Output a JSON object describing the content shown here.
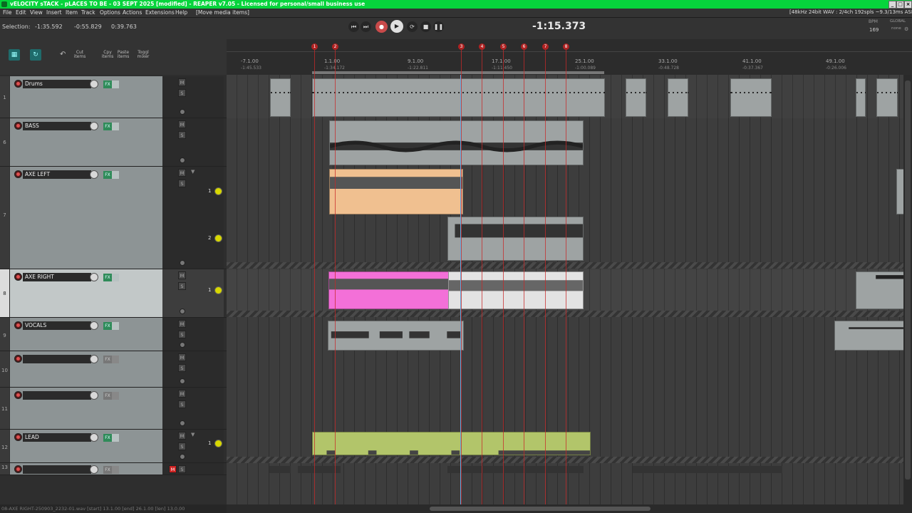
{
  "window": {
    "title": "vELOCITY sTACK - pLACES TO BE - 03 SEPT 2025 [modified] - REAPER v7.05 - Licensed for personal/small business use"
  },
  "menu": {
    "items": [
      "File",
      "Edit",
      "View",
      "Insert",
      "Item",
      "Track",
      "Options",
      "Actions",
      "Extensions",
      "Help",
      "[Move media items]"
    ],
    "audio_info": "[48kHz 24bit WAV : 2/4ch 192spls ~9.3/13ms ASIO]"
  },
  "selection": {
    "label": "Selection:",
    "start": "-1:35.592",
    "end": "-0:55.829",
    "length": "0:39.763"
  },
  "transport": {
    "time": "-1:15.373",
    "bpm_label": "BPM",
    "bpm": "169",
    "global_label": "GLOBAL",
    "none_label": "none"
  },
  "toolbar": {
    "cut_label": "Cut items",
    "copy_label": "Cpy items",
    "paste_label": "Paste items",
    "toggle_label": "Toggl mixer"
  },
  "ruler": {
    "bars": [
      "-7.1.00",
      "1.1.00",
      "9.1.00",
      "17.1.00",
      "25.1.00",
      "33.1.00",
      "41.1.00",
      "49.1.00"
    ],
    "times": [
      "-1:45.533",
      "-1:34.172",
      "-1:22.811",
      "-1:11.450",
      "-1:00.089",
      "-0:48.728",
      "-0:37.367",
      "-0:26.006"
    ],
    "markers": [
      "1",
      "2",
      "3",
      "4",
      "5",
      "6",
      "7",
      "8"
    ]
  },
  "tracks": [
    {
      "num": "1",
      "name": "Drums"
    },
    {
      "num": "6",
      "name": "BASS"
    },
    {
      "num": "7",
      "name": "AXE LEFT"
    },
    {
      "num": "8",
      "name": "AXE RIGHT"
    },
    {
      "num": "9",
      "name": "VOCALS"
    },
    {
      "num": "10",
      "name": ""
    },
    {
      "num": "11",
      "name": ""
    },
    {
      "num": "12",
      "name": "LEAD"
    },
    {
      "num": "13",
      "name": ""
    }
  ],
  "lanes": {
    "axe_left_1": "1",
    "axe_left_2": "2",
    "axe_right_1": "1",
    "lead_1": "1"
  },
  "buttons": {
    "fx": "FX",
    "mute": "M",
    "solo": "S"
  },
  "status": {
    "text": "08-AXE RIGHT-250903_2232-01.wav [start] 13.1.00 [end] 26.1.00 [len] 13.0.00"
  }
}
